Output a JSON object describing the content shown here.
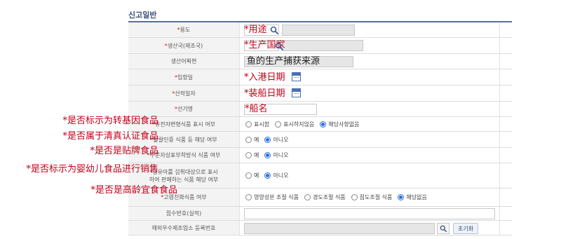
{
  "section_title": "신고일반",
  "rows": [
    {
      "label": "*용도",
      "annotation": "*用途"
    },
    {
      "label": "*생산국(제조국)",
      "annotation": "*生产国家"
    },
    {
      "label": "생산어획현",
      "annotation": "鱼的生产捕获来源"
    },
    {
      "label": "*입항일",
      "annotation": "*入港日期"
    },
    {
      "label": "*선적일자",
      "annotation": "*装船日期"
    },
    {
      "label": "*선기명",
      "annotation": "*船名"
    },
    {
      "label": "*유전자변형식품 표시 여부",
      "options": [
        "표시함",
        "표시하지않음",
        "해당사항없음"
      ],
      "selected": 2
    },
    {
      "label": "*할랄인증 식품 등 해당 여부",
      "options": [
        "예",
        "아니오"
      ],
      "selected": 1
    },
    {
      "label": "*주문자상표부착방식 식품 여부",
      "options": [
        "예",
        "아니오"
      ],
      "selected": 1
    },
    {
      "label_line1": "*영유아를 섭취대상으로 표시",
      "label_line2": "하여 판매하는 식품 해당 여부",
      "options": [
        "예",
        "아니오"
      ],
      "selected": 1
    },
    {
      "label": "*고령친화식품 여부",
      "options": [
        "영양성분 조절 식품",
        "경도조절 식품",
        "점도조절 식품",
        "해당없음"
      ],
      "selected": 3
    },
    {
      "label": "접수번호(실적)"
    },
    {
      "label": "해외우수제조업소 등록번호",
      "reset_button": "초기화"
    }
  ],
  "left_annotations": [
    "*是否标示为转基因食品",
    "*是否属于清真认证食品",
    "*是否是贴牌食品",
    "*是否标示为婴幼儿食品进行销售",
    "*是否是高龄宜食食品"
  ],
  "colors": {
    "annotation": "#c0001a",
    "header_rule": "#5a6f96",
    "radio_on": "#2a6fd8"
  },
  "icons": [
    "search-icon",
    "calendar-icon"
  ]
}
